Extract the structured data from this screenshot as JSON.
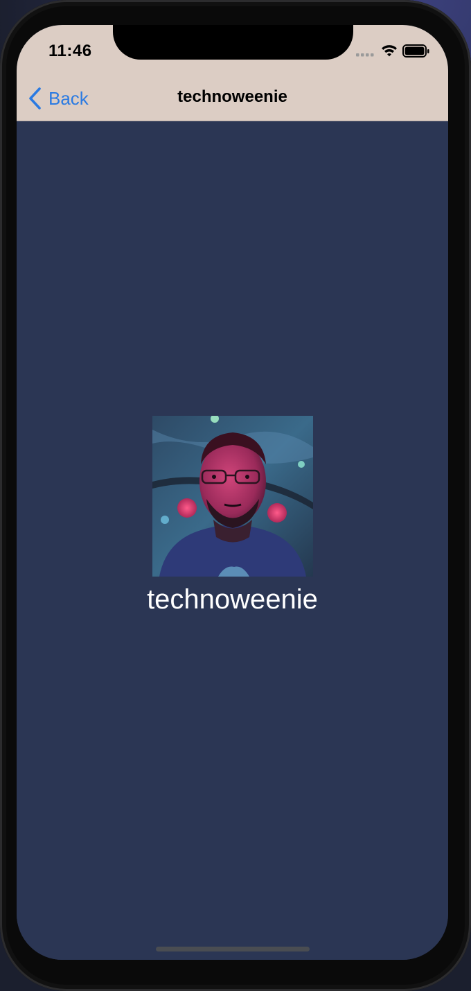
{
  "status_bar": {
    "time": "11:46",
    "signal_icon": "cellular-signal-icon",
    "wifi_icon": "wifi-icon",
    "battery_icon": "battery-icon"
  },
  "navbar": {
    "back_label": "Back",
    "back_icon": "chevron-left-icon",
    "title": "technoweenie",
    "background_color": "#dccdc4",
    "accent_color": "#2a7ae2"
  },
  "profile": {
    "avatar": "user-avatar-photo",
    "username": "technoweenie",
    "background_color": "#2b3654"
  }
}
